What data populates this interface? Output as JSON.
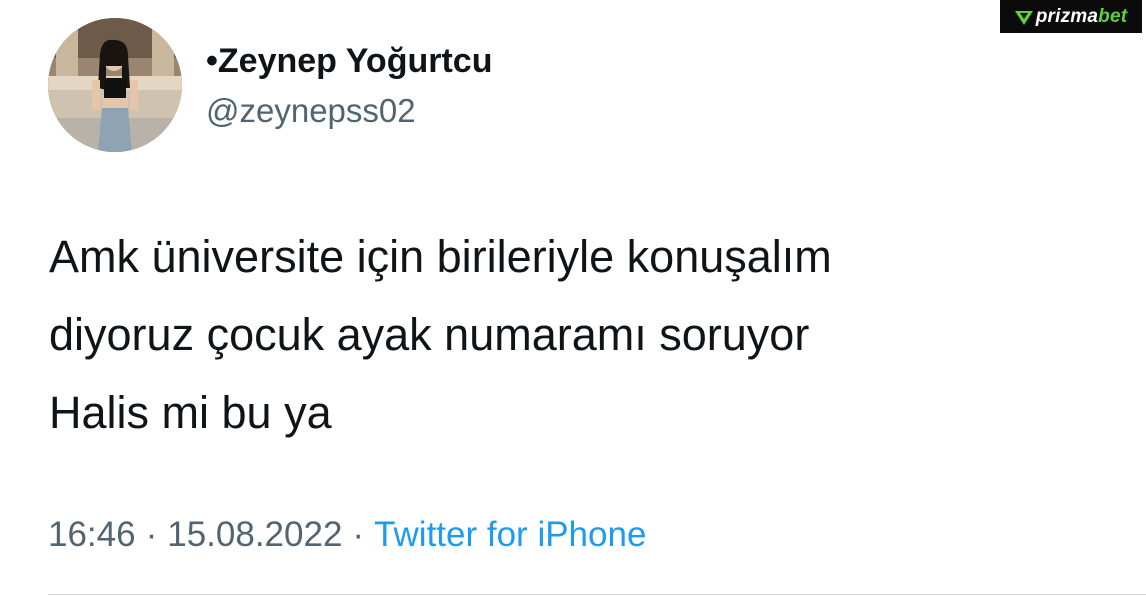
{
  "watermark": {
    "brand_part1": "prizma",
    "brand_part2": "bet",
    "icon": "triangle-logo-icon",
    "accent_color": "#5fcf3b"
  },
  "tweet": {
    "author": {
      "display_name": "•Zeynep Yoğurtcu",
      "handle": "@zeynepss02",
      "avatar_icon": "profile-avatar"
    },
    "text_lines": [
      "Amk üniversite için birileriyle konuşalım",
      "diyoruz çocuk ayak numaramı soruyor",
      "Halis mi bu ya"
    ],
    "time": "16:46",
    "separator": "·",
    "date": "15.08.2022",
    "source": "Twitter for iPhone",
    "colors": {
      "text": "#0f1419",
      "secondary": "#536471",
      "link": "#1d9bf0"
    }
  }
}
